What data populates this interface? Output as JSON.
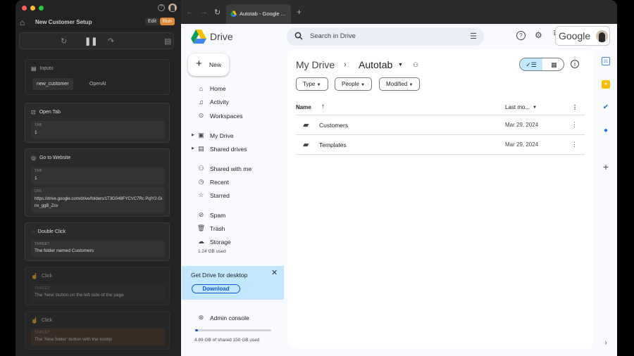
{
  "automation_panel": {
    "title": "New Customer Setup",
    "edit_label": "Edit",
    "run_label": "Run",
    "inputs": {
      "title": "Inputs",
      "chips": [
        "new_customer",
        "OpenAI"
      ]
    },
    "steps": [
      {
        "title": "Open Tab",
        "fields": [
          {
            "label": "TAB",
            "value": "1"
          }
        ]
      },
      {
        "title": "Go to Website",
        "fields": [
          {
            "label": "TAB",
            "value": "1"
          },
          {
            "label": "URL",
            "value": "https://drive.google.com/drive/folders/1T3G048FYCVC7Rc PqlY2-Ginx_ggB_Zcv"
          }
        ]
      },
      {
        "title": "Double Click",
        "fields": [
          {
            "label": "TARGET",
            "value": "The folder named Customers"
          }
        ]
      },
      {
        "title": "Click",
        "fields": [
          {
            "label": "TARGET",
            "value": "The 'New' button on the left side of the page"
          }
        ]
      },
      {
        "title": "Click",
        "fields": [
          {
            "label": "TARGET",
            "value": "The 'New folder' button with the tooltip"
          }
        ]
      }
    ]
  },
  "browser": {
    "tab_title": "Autotab - Google ...",
    "new_tab_label": "+"
  },
  "drive": {
    "brand": "Drive",
    "search_placeholder": "Search in Drive",
    "google_label": "Google",
    "new_label": "New",
    "nav": [
      {
        "label": "Home",
        "icon": "home-icon"
      },
      {
        "label": "Activity",
        "icon": "bell-icon"
      },
      {
        "label": "Workspaces",
        "icon": "workspaces-icon"
      },
      {
        "label": "My Drive",
        "icon": "my-drive-icon"
      },
      {
        "label": "Shared drives",
        "icon": "shared-drives-icon"
      },
      {
        "label": "Shared with me",
        "icon": "people-icon"
      },
      {
        "label": "Recent",
        "icon": "clock-icon"
      },
      {
        "label": "Starred",
        "icon": "star-icon"
      },
      {
        "label": "Spam",
        "icon": "spam-icon"
      },
      {
        "label": "Trash",
        "icon": "trash-icon"
      },
      {
        "label": "Storage",
        "icon": "cloud-icon"
      }
    ],
    "storage_used": "1.24 GB used",
    "promo": {
      "title": "Get Drive for desktop",
      "button": "Download"
    },
    "admin_console": "Admin console",
    "shared_storage": "4.89 GB of shared 150 GB used",
    "shared_storage_fraction": 0.033,
    "breadcrumb": {
      "parent": "My Drive",
      "current": "Autotab"
    },
    "filters": [
      "Type",
      "People",
      "Modified"
    ],
    "columns": {
      "name": "Name",
      "last_modified": "Last mo..."
    },
    "rows": [
      {
        "name": "Customers",
        "date": "Mar 29, 2024"
      },
      {
        "name": "Templates",
        "date": "Mar 29, 2024"
      }
    ],
    "colors": {
      "accent": "#0b57d0",
      "promo_bg": "#c2e7ff",
      "run_button": "#e0893b"
    }
  }
}
